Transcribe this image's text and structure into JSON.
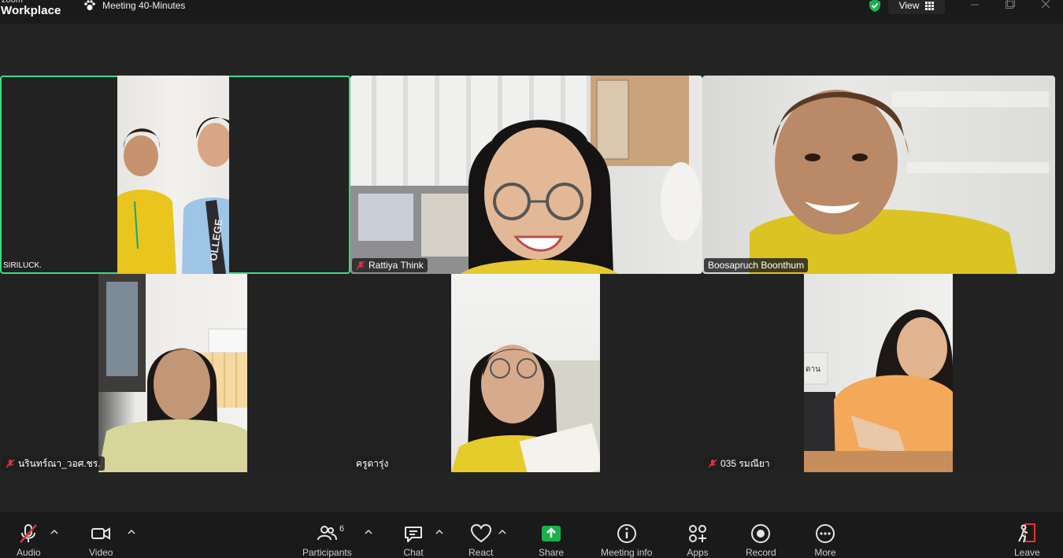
{
  "app": {
    "logo_small": "zoom",
    "logo_main": "Workplace",
    "meeting_title": "Meeting 40-Minutes",
    "view_label": "View"
  },
  "participants": [
    {
      "name": "SIRILUCK.",
      "muted": false,
      "active_speaker": true
    },
    {
      "name": "Rattiya Think",
      "muted": true,
      "active_speaker": false
    },
    {
      "name": "Boosapruch Boonthum",
      "muted": false,
      "active_speaker": false
    },
    {
      "name": "นรินทร์ณา_วอศ.ชร.",
      "muted": true,
      "active_speaker": false
    },
    {
      "name": "ครูดารุ่ง",
      "muted": false,
      "active_speaker": false
    },
    {
      "name": "035 รมณียา",
      "muted": true,
      "active_speaker": false
    }
  ],
  "toolbar": {
    "audio": "Audio",
    "video": "Video",
    "participants": "Participants",
    "participants_count": "6",
    "chat": "Chat",
    "react": "React",
    "share": "Share",
    "meeting_info": "Meeting info",
    "apps": "Apps",
    "record": "Record",
    "more": "More",
    "leave": "Leave"
  },
  "colors": {
    "active_border": "#3ddc84",
    "share_green": "#17b34a",
    "muted_red": "#e0323a",
    "leave_red": "#e0323a"
  }
}
